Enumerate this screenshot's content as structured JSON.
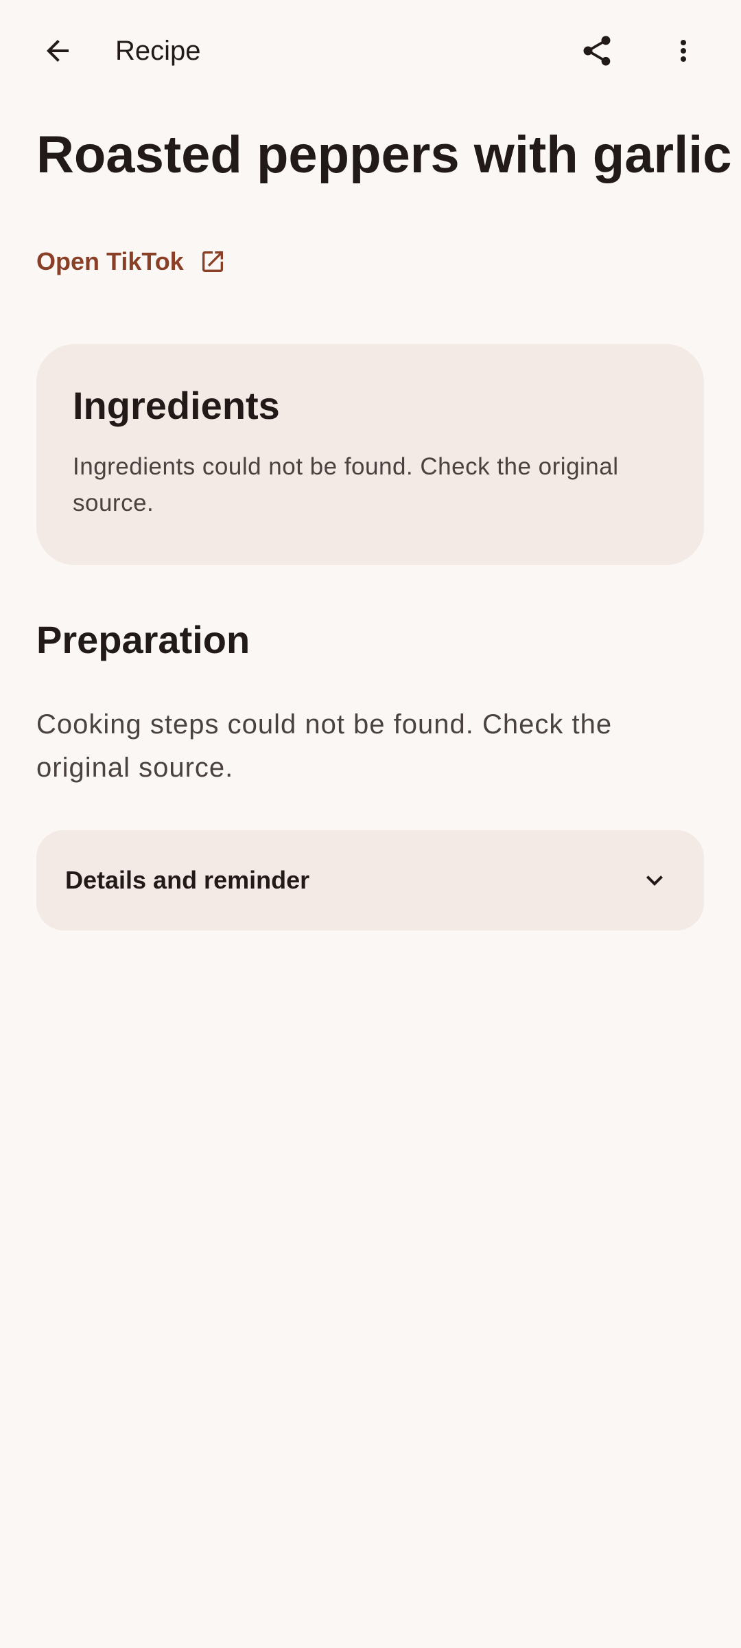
{
  "app_bar": {
    "title": "Recipe",
    "icons": {
      "back": "arrow-back-icon",
      "share": "share-icon",
      "more": "more-vert-icon"
    }
  },
  "recipe": {
    "title": "Roasted peppers with garlic",
    "source_link_label": "Open TikTok",
    "source_link_icon": "open-in-new-icon"
  },
  "ingredients": {
    "heading": "Ingredients",
    "message": "Ingredients could not be found. Check the original source."
  },
  "preparation": {
    "heading": "Preparation",
    "message": "Cooking steps could not be found. Check the original source."
  },
  "details": {
    "label": "Details and reminder",
    "icon": "chevron-down-icon"
  },
  "colors": {
    "background": "#fbf7f4",
    "surface": "#f3e9e5",
    "accent": "#8a3f27",
    "text_primary": "#211a18",
    "text_secondary": "#4a423f"
  }
}
